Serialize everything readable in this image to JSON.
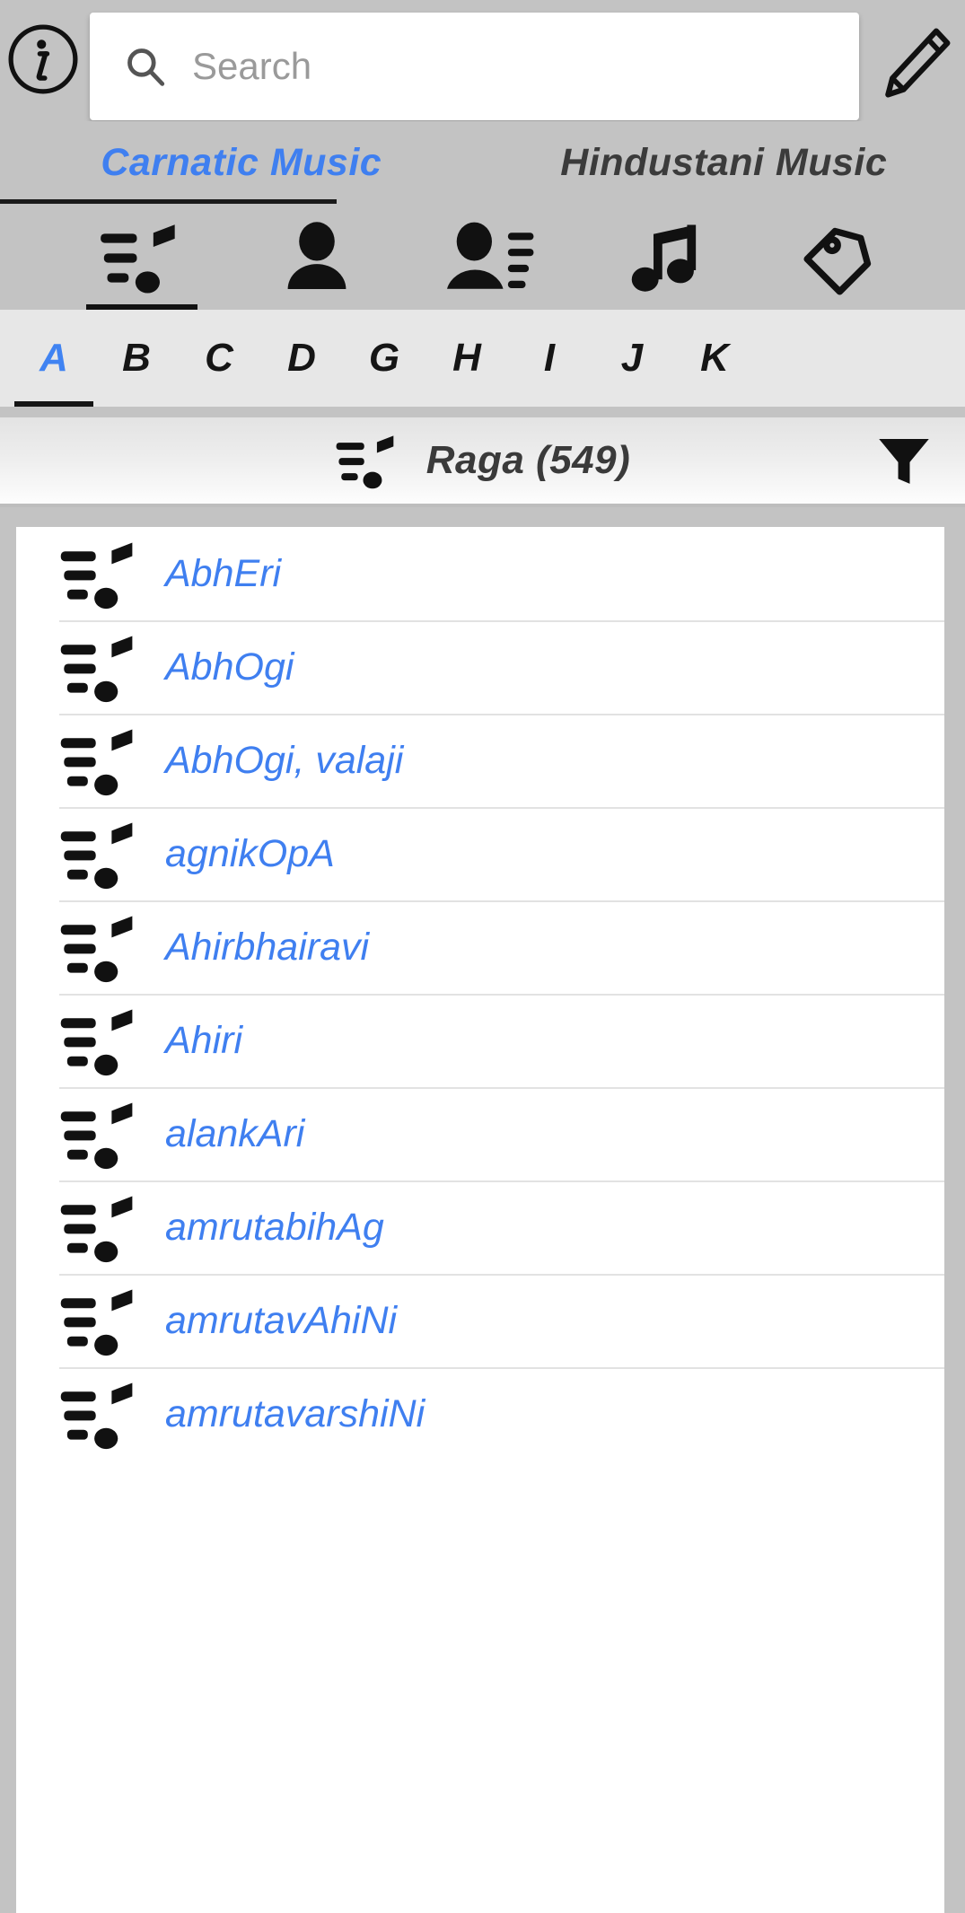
{
  "topbar": {
    "info_icon": "info-circle-icon",
    "search": {
      "icon": "search-icon",
      "value": "",
      "placeholder": "Search"
    },
    "edit_icon": "pencil-icon"
  },
  "main_tabs": [
    {
      "label": "Carnatic Music",
      "active": true
    },
    {
      "label": "Hindustani Music",
      "active": false
    }
  ],
  "icon_tabs": [
    {
      "name": "raga-list-icon",
      "active": true
    },
    {
      "name": "person-icon",
      "active": false
    },
    {
      "name": "person-list-icon",
      "active": false
    },
    {
      "name": "music-note-icon",
      "active": false
    },
    {
      "name": "tag-icon",
      "active": false
    }
  ],
  "alphabet": [
    {
      "letter": "A",
      "active": true
    },
    {
      "letter": "B",
      "active": false
    },
    {
      "letter": "C",
      "active": false
    },
    {
      "letter": "D",
      "active": false
    },
    {
      "letter": "G",
      "active": false
    },
    {
      "letter": "H",
      "active": false
    },
    {
      "letter": "I",
      "active": false
    },
    {
      "letter": "J",
      "active": false
    },
    {
      "letter": "K",
      "active": false
    }
  ],
  "section_header": {
    "icon": "raga-list-icon",
    "title": "Raga (549)",
    "filter_icon": "filter-funnel-icon"
  },
  "list": {
    "items": [
      {
        "name": "AbhEri"
      },
      {
        "name": "AbhOgi"
      },
      {
        "name": "AbhOgi, valaji"
      },
      {
        "name": "agnikOpA"
      },
      {
        "name": "Ahirbhairavi"
      },
      {
        "name": "Ahiri"
      },
      {
        "name": "alankAri"
      },
      {
        "name": "amrutabihAg"
      },
      {
        "name": "amrutavAhiNi"
      },
      {
        "name": "amrutavarshiNi"
      }
    ]
  },
  "colors": {
    "accent_blue": "#3f7ff0",
    "background_gray": "#c3c3c3",
    "strip_gray": "#e7e7e7",
    "card_white": "#ffffff"
  }
}
